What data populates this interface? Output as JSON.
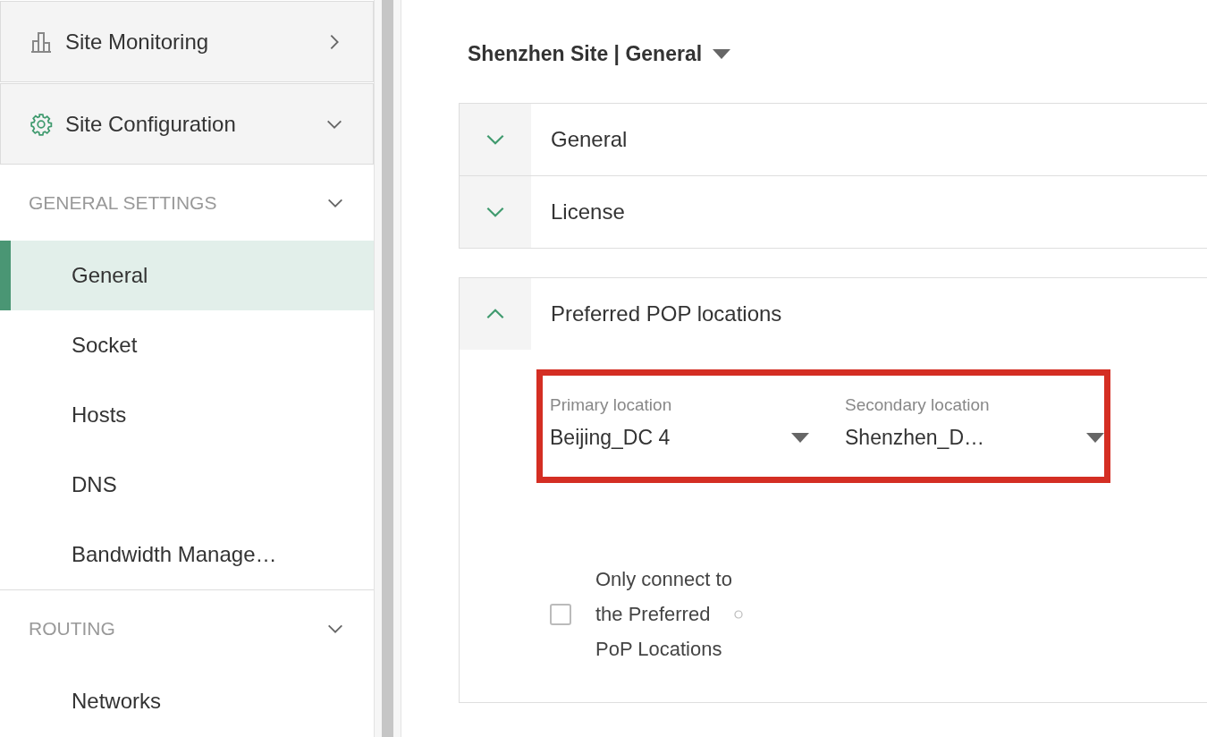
{
  "sidebar": {
    "top_items": [
      {
        "label": "Site Monitoring",
        "kind": "monitoring",
        "expanded": false
      },
      {
        "label": "Site Configuration",
        "kind": "configuration",
        "expanded": true
      }
    ],
    "sections": [
      {
        "title": "GENERAL SETTINGS",
        "expanded": true,
        "items": [
          {
            "label": "General",
            "selected": true
          },
          {
            "label": "Socket",
            "selected": false
          },
          {
            "label": "Hosts",
            "selected": false
          },
          {
            "label": "DNS",
            "selected": false
          },
          {
            "label": "Bandwidth Manage…",
            "selected": false
          }
        ]
      },
      {
        "title": "ROUTING",
        "expanded": true,
        "items": [
          {
            "label": "Networks",
            "selected": false
          }
        ]
      }
    ]
  },
  "breadcrumb": "Shenzhen Site | General",
  "panels": [
    {
      "title": "General",
      "expanded": false
    },
    {
      "title": "License",
      "expanded": false
    },
    {
      "title": "Preferred POP locations",
      "expanded": true,
      "highlighted": true,
      "fields": [
        {
          "label": "Primary location",
          "value": "Beijing_DC 4"
        },
        {
          "label": "Secondary location",
          "value": "Shenzhen_D…"
        }
      ],
      "checkbox": {
        "label": "Only connect to the Preferred PoP Locations",
        "checked": false
      }
    }
  ]
}
